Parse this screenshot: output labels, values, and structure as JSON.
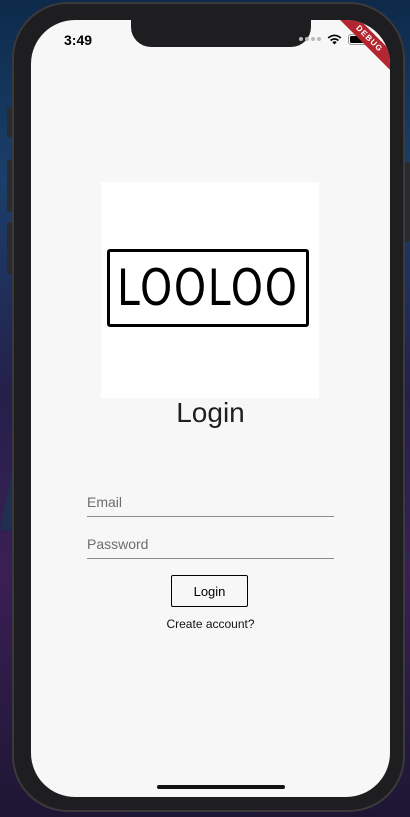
{
  "status_bar": {
    "time": "3:49",
    "debug_label": "DEBUG"
  },
  "logo": {
    "text": "LOOLOO"
  },
  "page": {
    "title": "Login"
  },
  "form": {
    "email_placeholder": "Email",
    "password_placeholder": "Password",
    "login_label": "Login",
    "create_account_label": "Create account?"
  },
  "colors": {
    "screen_background": "#f7f7f7",
    "debug_ribbon": "#b3262f",
    "text": "#1f1f1f",
    "underline": "#8b8b8b"
  }
}
